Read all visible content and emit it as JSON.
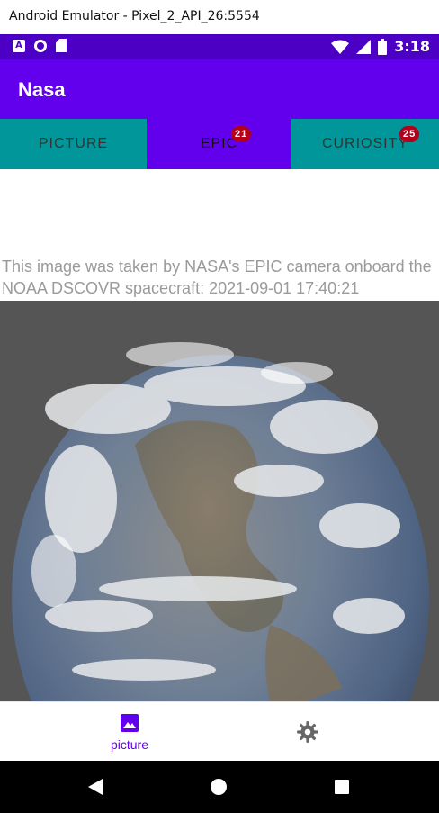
{
  "window": {
    "title": "Android Emulator - Pixel_2_API_26:5554"
  },
  "status_bar": {
    "time": "3:18",
    "left_icons": [
      "A"
    ]
  },
  "app_bar": {
    "title": "Nasa"
  },
  "tabs": [
    {
      "label": "PICTURE",
      "badge": null,
      "active": false
    },
    {
      "label": "EPIC",
      "badge": "21",
      "active": true
    },
    {
      "label": "CURIOSITY",
      "badge": "25",
      "active": false
    }
  ],
  "content": {
    "caption": "This image was taken by NASA's EPIC camera onboard the NOAA DSCOVR spacecraft: 2021-09-01 17:40:21"
  },
  "bottom_nav": [
    {
      "label": "picture",
      "icon": "image-icon",
      "selected": true
    },
    {
      "label": "",
      "icon": "gear-icon",
      "selected": false
    }
  ],
  "colors": {
    "primary": "#6200ee",
    "status": "#4b00c4",
    "tab": "#00969a",
    "badge": "#b3001b"
  }
}
